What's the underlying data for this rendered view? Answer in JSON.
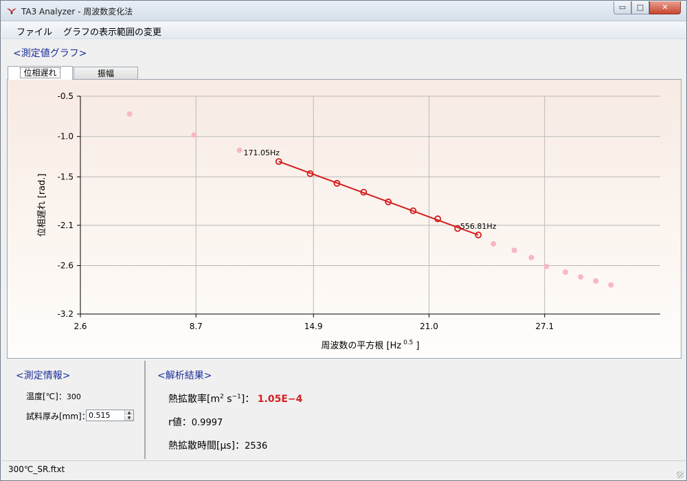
{
  "window": {
    "title": "TA3 Analyzer - 周波数変化法",
    "controls": {
      "minimize": "▭",
      "maximize": "□",
      "close": "✕"
    }
  },
  "menu": {
    "items": [
      "ファイル",
      "グラフの表示範囲の変更"
    ]
  },
  "graph_section": {
    "title": "<測定値グラフ>"
  },
  "tabs": [
    {
      "label": "位相遅れ",
      "active": true
    },
    {
      "label": "振幅",
      "active": false
    }
  ],
  "chart_data": {
    "type": "scatter",
    "xlabel": "周波数の平方根 [Hz",
    "xlabel_sup": "0.5",
    "xlabel_close": "]",
    "ylabel": "位相遅れ [rad.]",
    "x_ticks": [
      "2.6",
      "8.7",
      "14.9",
      "21.0",
      "27.1"
    ],
    "x_tick_values": [
      2.6,
      8.7,
      14.9,
      21.0,
      27.1
    ],
    "y_ticks": [
      "-0.5",
      "-1.0",
      "-1.5",
      "-2.1",
      "-2.6",
      "-3.2"
    ],
    "y_tick_values": [
      -0.5,
      -1.0,
      -1.5,
      -2.1,
      -2.6,
      -3.2
    ],
    "xlim": [
      2.6,
      33.2
    ],
    "ylim": [
      -3.2,
      -0.5
    ],
    "grid": true,
    "series": [
      {
        "points": [
          [
            5.2,
            -0.72
          ],
          [
            8.6,
            -0.98
          ],
          [
            11.0,
            -1.17
          ],
          [
            26.4,
            -2.5
          ],
          [
            27.2,
            -2.61
          ],
          [
            28.2,
            -2.68
          ],
          [
            29.0,
            -2.74
          ],
          [
            29.8,
            -2.79
          ],
          [
            30.6,
            -2.84
          ],
          [
            24.4,
            -2.33
          ],
          [
            25.5,
            -2.41
          ]
        ],
        "color": "#f7b8c3"
      },
      {
        "points": [
          [
            13.07,
            -1.31
          ],
          [
            14.73,
            -1.46
          ],
          [
            16.14,
            -1.58
          ],
          [
            17.55,
            -1.69
          ],
          [
            18.85,
            -1.81
          ],
          [
            20.16,
            -1.92
          ],
          [
            21.46,
            -2.02
          ],
          [
            22.51,
            -2.14
          ],
          [
            23.6,
            -2.22
          ]
        ],
        "color": "#d21d1d",
        "fit_line": [
          [
            13.07,
            -1.31
          ],
          [
            23.6,
            -2.22
          ]
        ]
      }
    ],
    "annotations": [
      {
        "text": "171.05Hz",
        "x": 13.07,
        "y": -1.31,
        "anchor": "above-left"
      },
      {
        "text": "556.81Hz",
        "x": 23.6,
        "y": -2.22,
        "anchor": "above-left"
      }
    ]
  },
  "measurement_info": {
    "title": "<測定情報>",
    "temperature_label": "温度[℃]：",
    "temperature_value": "300",
    "thickness_label": "試料厚み[mm]：",
    "thickness_value": "0.515"
  },
  "analysis_result": {
    "title": "<解析結果>",
    "diffusivity_label": "熱拡散率[m",
    "diffusivity_sup1": "2",
    "diffusivity_mid": " s",
    "diffusivity_sup2": "−1",
    "diffusivity_end": "]：",
    "diffusivity_value": "1.05E−4",
    "r_label": "r値：",
    "r_value": "0.9997",
    "time_label": "熱拡散時間[μs]：",
    "time_value": "2536"
  },
  "status": {
    "filename": "300℃_SR.ftxt"
  },
  "colors": {
    "accent_blue": "#1d2f9a",
    "emphasis_red": "#d41f1f",
    "fit_line": "#d21d1d",
    "faded_point": "#f7b8c3"
  }
}
